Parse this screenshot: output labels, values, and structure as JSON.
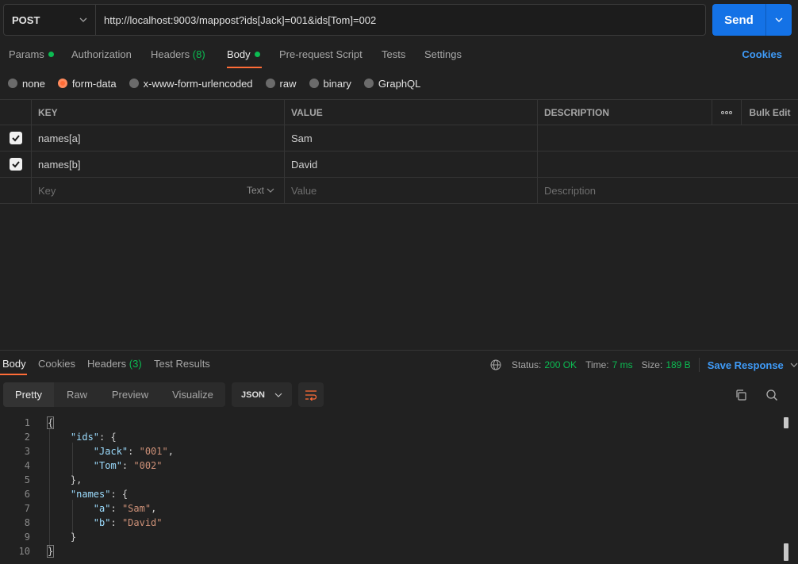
{
  "request": {
    "method": "POST",
    "url": "http://localhost:9003/mappost?ids[Jack]=001&ids[Tom]=002",
    "send_label": "Send"
  },
  "tabs": {
    "params": "Params",
    "authorization": "Authorization",
    "headers": "Headers",
    "headers_count": "(8)",
    "body": "Body",
    "prerequest": "Pre-request Script",
    "tests": "Tests",
    "settings": "Settings",
    "cookies": "Cookies"
  },
  "body_types": [
    "none",
    "form-data",
    "x-www-form-urlencoded",
    "raw",
    "binary",
    "GraphQL"
  ],
  "table": {
    "headers": {
      "key": "KEY",
      "value": "VALUE",
      "description": "DESCRIPTION",
      "bulk_edit": "Bulk Edit"
    },
    "rows": [
      {
        "key": "names[a]",
        "value": "Sam"
      },
      {
        "key": "names[b]",
        "value": "David"
      }
    ],
    "placeholders": {
      "key": "Key",
      "type": "Text",
      "value": "Value",
      "description": "Description"
    }
  },
  "response": {
    "tabs": {
      "body": "Body",
      "cookies": "Cookies",
      "headers": "Headers",
      "headers_count": "(3)",
      "test_results": "Test Results"
    },
    "status_label": "Status:",
    "status_value": "200 OK",
    "time_label": "Time:",
    "time_value": "7 ms",
    "size_label": "Size:",
    "size_value": "189 B",
    "save_label": "Save Response",
    "views": [
      "Pretty",
      "Raw",
      "Preview",
      "Visualize"
    ],
    "format": "JSON"
  },
  "code_lines": [
    "1",
    "2",
    "3",
    "4",
    "5",
    "6",
    "7",
    "8",
    "9",
    "10"
  ],
  "json": {
    "ids_key": "\"ids\"",
    "jack_key": "\"Jack\"",
    "jack_val": "\"001\"",
    "tom_key": "\"Tom\"",
    "tom_val": "\"002\"",
    "names_key": "\"names\"",
    "a_key": "\"a\"",
    "a_val": "\"Sam\"",
    "b_key": "\"b\"",
    "b_val": "\"David\""
  }
}
